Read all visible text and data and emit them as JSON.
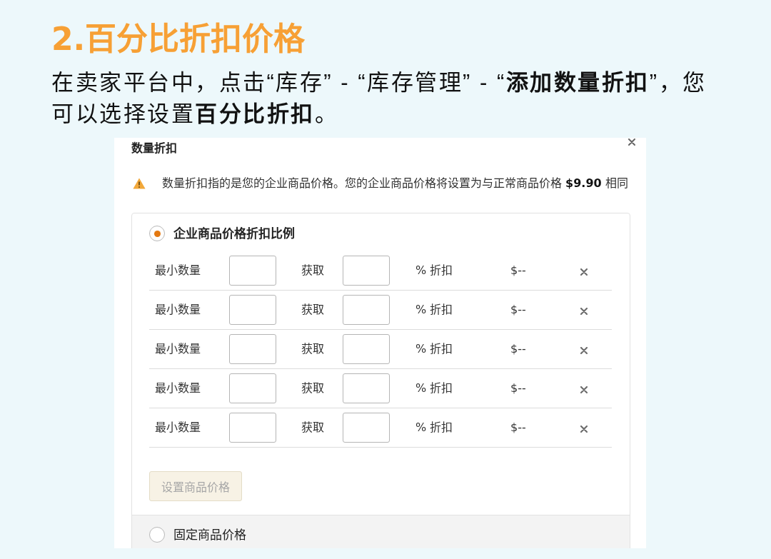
{
  "heading": "2.百分比折扣价格",
  "intro": "在卖家平台中，点击“库存” - “库存管理” - “**添加数量折扣**”，您可以选择设置**百分比折扣**。",
  "dialog": {
    "title": "数量折扣",
    "warning": "数量折扣指的是您的企业商品价格。您的企业商品价格将设置为与正常商品价格 **$9.90** 相同",
    "options": [
      {
        "label": "企业商品价格折扣比例",
        "selected": true,
        "tiers": [
          {
            "min_label": "最小数量",
            "get_label": "获取",
            "unit": "% 折扣",
            "price": "$--"
          },
          {
            "min_label": "最小数量",
            "get_label": "获取",
            "unit": "% 折扣",
            "price": "$--"
          },
          {
            "min_label": "最小数量",
            "get_label": "获取",
            "unit": "% 折扣",
            "price": "$--"
          },
          {
            "min_label": "最小数量",
            "get_label": "获取",
            "unit": "% 折扣",
            "price": "$--"
          },
          {
            "min_label": "最小数量",
            "get_label": "获取",
            "unit": "% 折扣",
            "price": "$--"
          }
        ],
        "button": {
          "label": "设置商品价格",
          "disabled": true
        }
      },
      {
        "label": "固定商品价格",
        "selected": false
      }
    ]
  }
}
